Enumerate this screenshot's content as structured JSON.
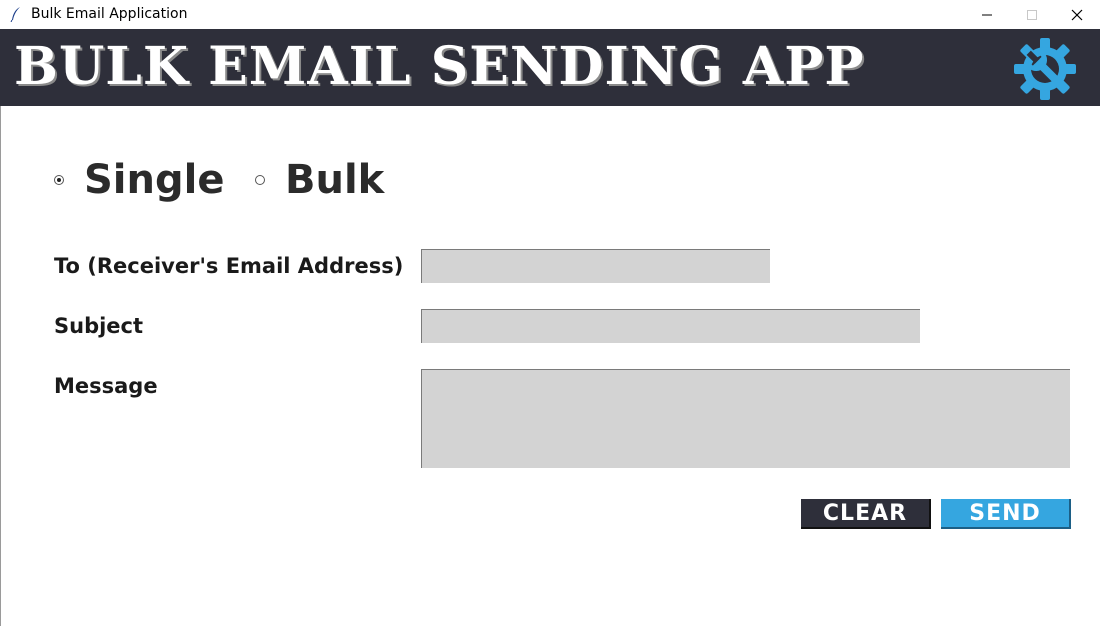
{
  "window": {
    "title": "Bulk Email Application",
    "icon": "feather-icon",
    "controls": [
      "minimize-icon",
      "maximize-icon",
      "close-icon"
    ]
  },
  "header": {
    "title": "BULK EMAIL SENDING APP",
    "settings_icon": "gear-wrench-icon",
    "background_color": "#2e2f3a",
    "accent_color": "#35a6e0"
  },
  "mode": {
    "options": [
      {
        "label": "Single",
        "selected": true
      },
      {
        "label": "Bulk",
        "selected": false
      }
    ]
  },
  "form": {
    "to_label": "To (Receiver's Email Address)",
    "to_value": "",
    "subject_label": "Subject",
    "subject_value": "",
    "message_label": "Message",
    "message_value": ""
  },
  "buttons": {
    "clear_label": "CLEAR",
    "send_label": "SEND"
  }
}
